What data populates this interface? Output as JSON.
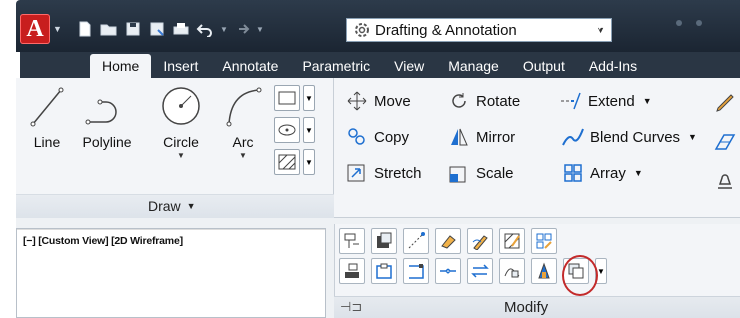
{
  "app": {
    "logo_letter": "A",
    "logo_color": "#c81e1e"
  },
  "quick_access": {
    "icons": [
      "new-icon",
      "open-icon",
      "save-icon",
      "save-as-icon",
      "plot-icon",
      "undo-icon",
      "redo-icon"
    ]
  },
  "workspace": {
    "value": "Drafting & Annotation"
  },
  "tabs": [
    {
      "label": "Home"
    },
    {
      "label": "Insert"
    },
    {
      "label": "Annotate"
    },
    {
      "label": "Parametric"
    },
    {
      "label": "View"
    },
    {
      "label": "Manage"
    },
    {
      "label": "Output"
    },
    {
      "label": "Add-Ins"
    }
  ],
  "draw_panel": {
    "title": "Draw",
    "tools": [
      {
        "label": "Line"
      },
      {
        "label": "Polyline"
      },
      {
        "label": "Circle"
      },
      {
        "label": "Arc"
      }
    ]
  },
  "modify_panel": {
    "title": "Modify",
    "tools": [
      {
        "label": "Move"
      },
      {
        "label": "Rotate"
      },
      {
        "label": "Extend"
      },
      {
        "label": "Copy"
      },
      {
        "label": "Mirror"
      },
      {
        "label": "Blend Curves"
      },
      {
        "label": "Stretch"
      },
      {
        "label": "Scale"
      },
      {
        "label": "Array"
      }
    ]
  },
  "viewport": {
    "label": "[−] [Custom View] [2D Wireframe]"
  },
  "colors": {
    "title_bar": "#1f2a37",
    "ribbon_bg": "#f3f5f8",
    "highlight_circle": "#c32a2a",
    "accent_blue": "#1e6fd0"
  }
}
